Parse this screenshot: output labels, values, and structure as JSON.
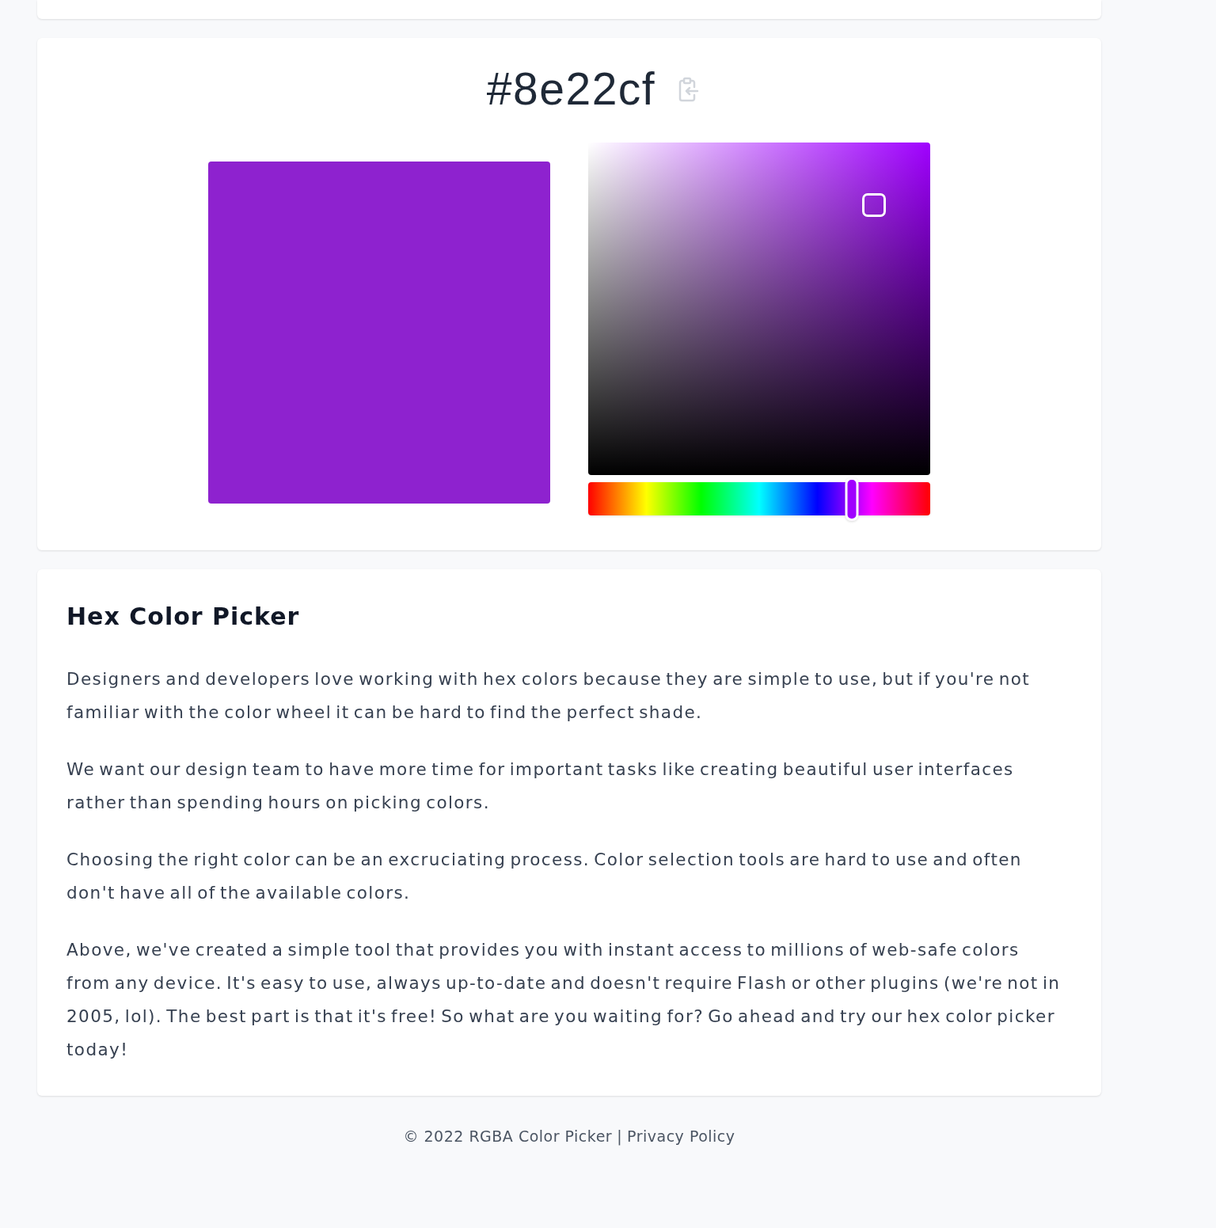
{
  "picker": {
    "hex": "#8e22cf",
    "swatch": {
      "color": "#8e22cf"
    },
    "color_field": {
      "saturation": {
        "level": 0.836
      },
      "brightness": {
        "level": 0.812
      }
    },
    "hue_slider": {
      "level": 0.771
    }
  },
  "article": {
    "heading": "Hex Color Picker",
    "paragraphs": [
      "Designers and developers love working with hex colors because they are simple to use, but if you're not familiar with the color wheel it can be hard to find the perfect shade.",
      "We want our design team to have more time for important tasks like creating beautiful user interfaces rather than spending hours on picking colors.",
      "Choosing the right color can be an excruciating process. Color selection tools are hard to use and often don't have all of the available colors.",
      "Above, we've created a simple tool that provides you with instant access to millions of web-safe colors from any device. It's easy to use, always up-to-date and doesn't require Flash or other plugins (we're not in 2005, lol). The best part is that it's free! So what are you waiting for? Go ahead and try our hex color picker today!"
    ]
  },
  "footer": {
    "copyright": "© 2022 RGBA Color Picker",
    "separator": "|",
    "link": "Privacy Policy"
  }
}
